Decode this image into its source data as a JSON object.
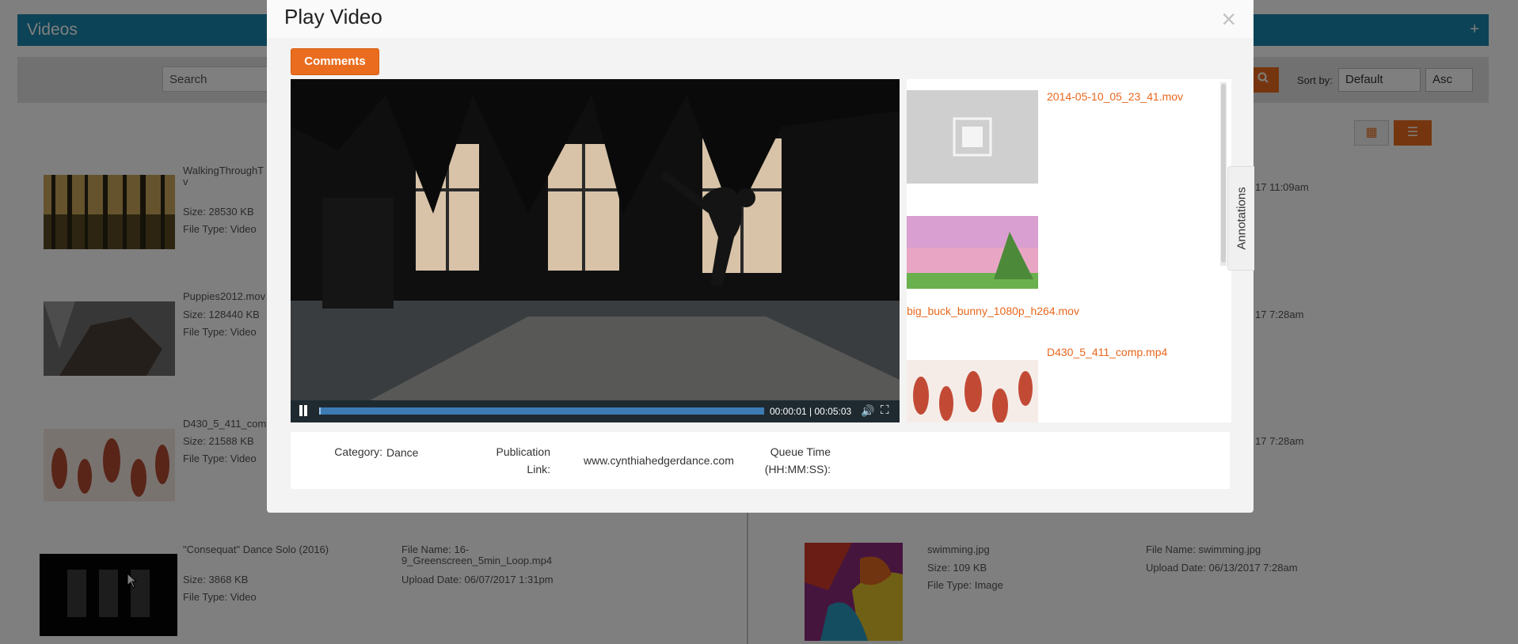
{
  "background": {
    "header_title": "Videos",
    "search_placeholder": "Search",
    "sort_label": "Sort by:",
    "sort_value": "Default",
    "order_value": "Asc",
    "items": [
      {
        "name": "WalkingThroughT",
        "name_cont": "v",
        "size": "Size: 28530 KB",
        "type": "File Type: Video"
      },
      {
        "name": "Puppies2012.mov",
        "size": "Size: 128440 KB",
        "type": "File Type: Video"
      },
      {
        "name": "D430_5_411_com",
        "size": "Size: 21588 KB",
        "type": "File Type: Video"
      },
      {
        "name": "\"Consequat\" Dance Solo (2016)",
        "size": "Size: 3868 KB",
        "type": "File Type: Video",
        "file_name": "File Name: 16-",
        "file_name_cont": "9_Greenscreen_5min_Loop.mp4",
        "upload": "Upload Date: 06/07/2017 1:31pm"
      }
    ],
    "right_dates": [
      "17 11:09am",
      "17 7:28am",
      "17 7:28am"
    ],
    "right_item": {
      "name": "swimming.jpg",
      "size": "Size: 109 KB",
      "type": "File Type: Image",
      "file_name": "File Name: swimming.jpg",
      "upload": "Upload Date: 06/13/2017 7:28am"
    }
  },
  "modal": {
    "title": "Play Video",
    "close_symbol": "×",
    "comments_label": "Comments",
    "player": {
      "time": "00:00:01 | 00:05:03",
      "progress_fraction": 0.003
    },
    "playlist": [
      {
        "name": "2014-05-10_05_23_41.mov"
      },
      {
        "name": "big_buck_bunny_1080p_h264.mov"
      },
      {
        "name": "D430_5_411_comp.mp4"
      }
    ],
    "annotations_label": "Annotations",
    "info": {
      "category_label": "Category:",
      "category_value": "Dance",
      "publication_label_1": "Publication",
      "publication_label_2": "Link:",
      "publication_value": "www.cynthiahedgerdance.com",
      "queue_label_1": "Queue Time",
      "queue_label_2": "(HH:MM:SS):",
      "queue_value": ""
    }
  },
  "colors": {
    "accent": "#ea6d1f",
    "header": "#1b86ad",
    "link": "#e8671c"
  }
}
